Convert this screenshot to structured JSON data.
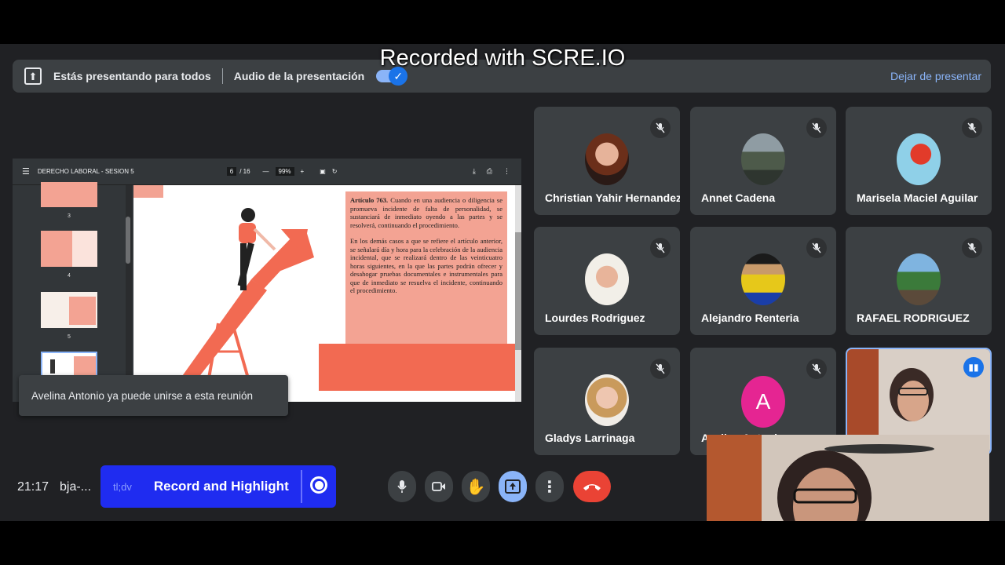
{
  "watermark": "Recorded with SCRE.IO",
  "present_bar": {
    "presenting_text": "Estás presentando para todos",
    "audio_text": "Audio de la presentación",
    "audio_enabled": true,
    "stop_label": "Dejar de presentar"
  },
  "pdf": {
    "title": "DERECHO LABORAL - SESION 5",
    "current_page": "6",
    "total_pages": "/ 16",
    "zoom": "99%",
    "thumbs": [
      "3",
      "4",
      "5"
    ],
    "article_title": "Artículo 763.",
    "article_p1": " Cuando en una audiencia o diligencia se promueva incidente de falta de personalidad, se sustanciará de inmediato oyendo a las partes y se resolverá, continuando el procedimiento.",
    "article_p2": "En los demás casos a que se refiere el artículo anterior, se señalará día y hora para la celebración de la audiencia incidental, que se realizará dentro de las veinticuatro horas siguientes, en la que las partes podrán ofrecer y desahogar pruebas documentales e instrumentales para que de inmediato se resuelva el incidente, continuando el procedimiento."
  },
  "toast": "Avelina Antonio ya puede unirse a esta reunión",
  "participants": [
    {
      "name": "Christian Yahir Hernandez",
      "muted": true
    },
    {
      "name": "Annet Cadena",
      "muted": true
    },
    {
      "name": "Marisela Maciel Aguilar",
      "muted": true
    },
    {
      "name": "Lourdes Rodriguez",
      "muted": true
    },
    {
      "name": "Alejandro Renteria",
      "muted": true
    },
    {
      "name": "RAFAEL RODRIGUEZ",
      "muted": true
    },
    {
      "name": "Gladys Larrinaga",
      "muted": true
    },
    {
      "name": "Avelina Antonio",
      "initial": "A",
      "muted": true
    },
    {
      "name": "",
      "speaking": true
    }
  ],
  "bottom": {
    "time": "21:17",
    "meeting_code": "bja-...",
    "record_brand": "tl;dv",
    "record_label": "Record and Highlight"
  },
  "colors": {
    "background": "#202124",
    "tile": "#3c4043",
    "accent_blue": "#8ab4f8",
    "hangup_red": "#ea4335",
    "tldv_blue": "#1f2cf0",
    "slide_salmon": "#f3a393",
    "slide_coral": "#f26a52"
  }
}
